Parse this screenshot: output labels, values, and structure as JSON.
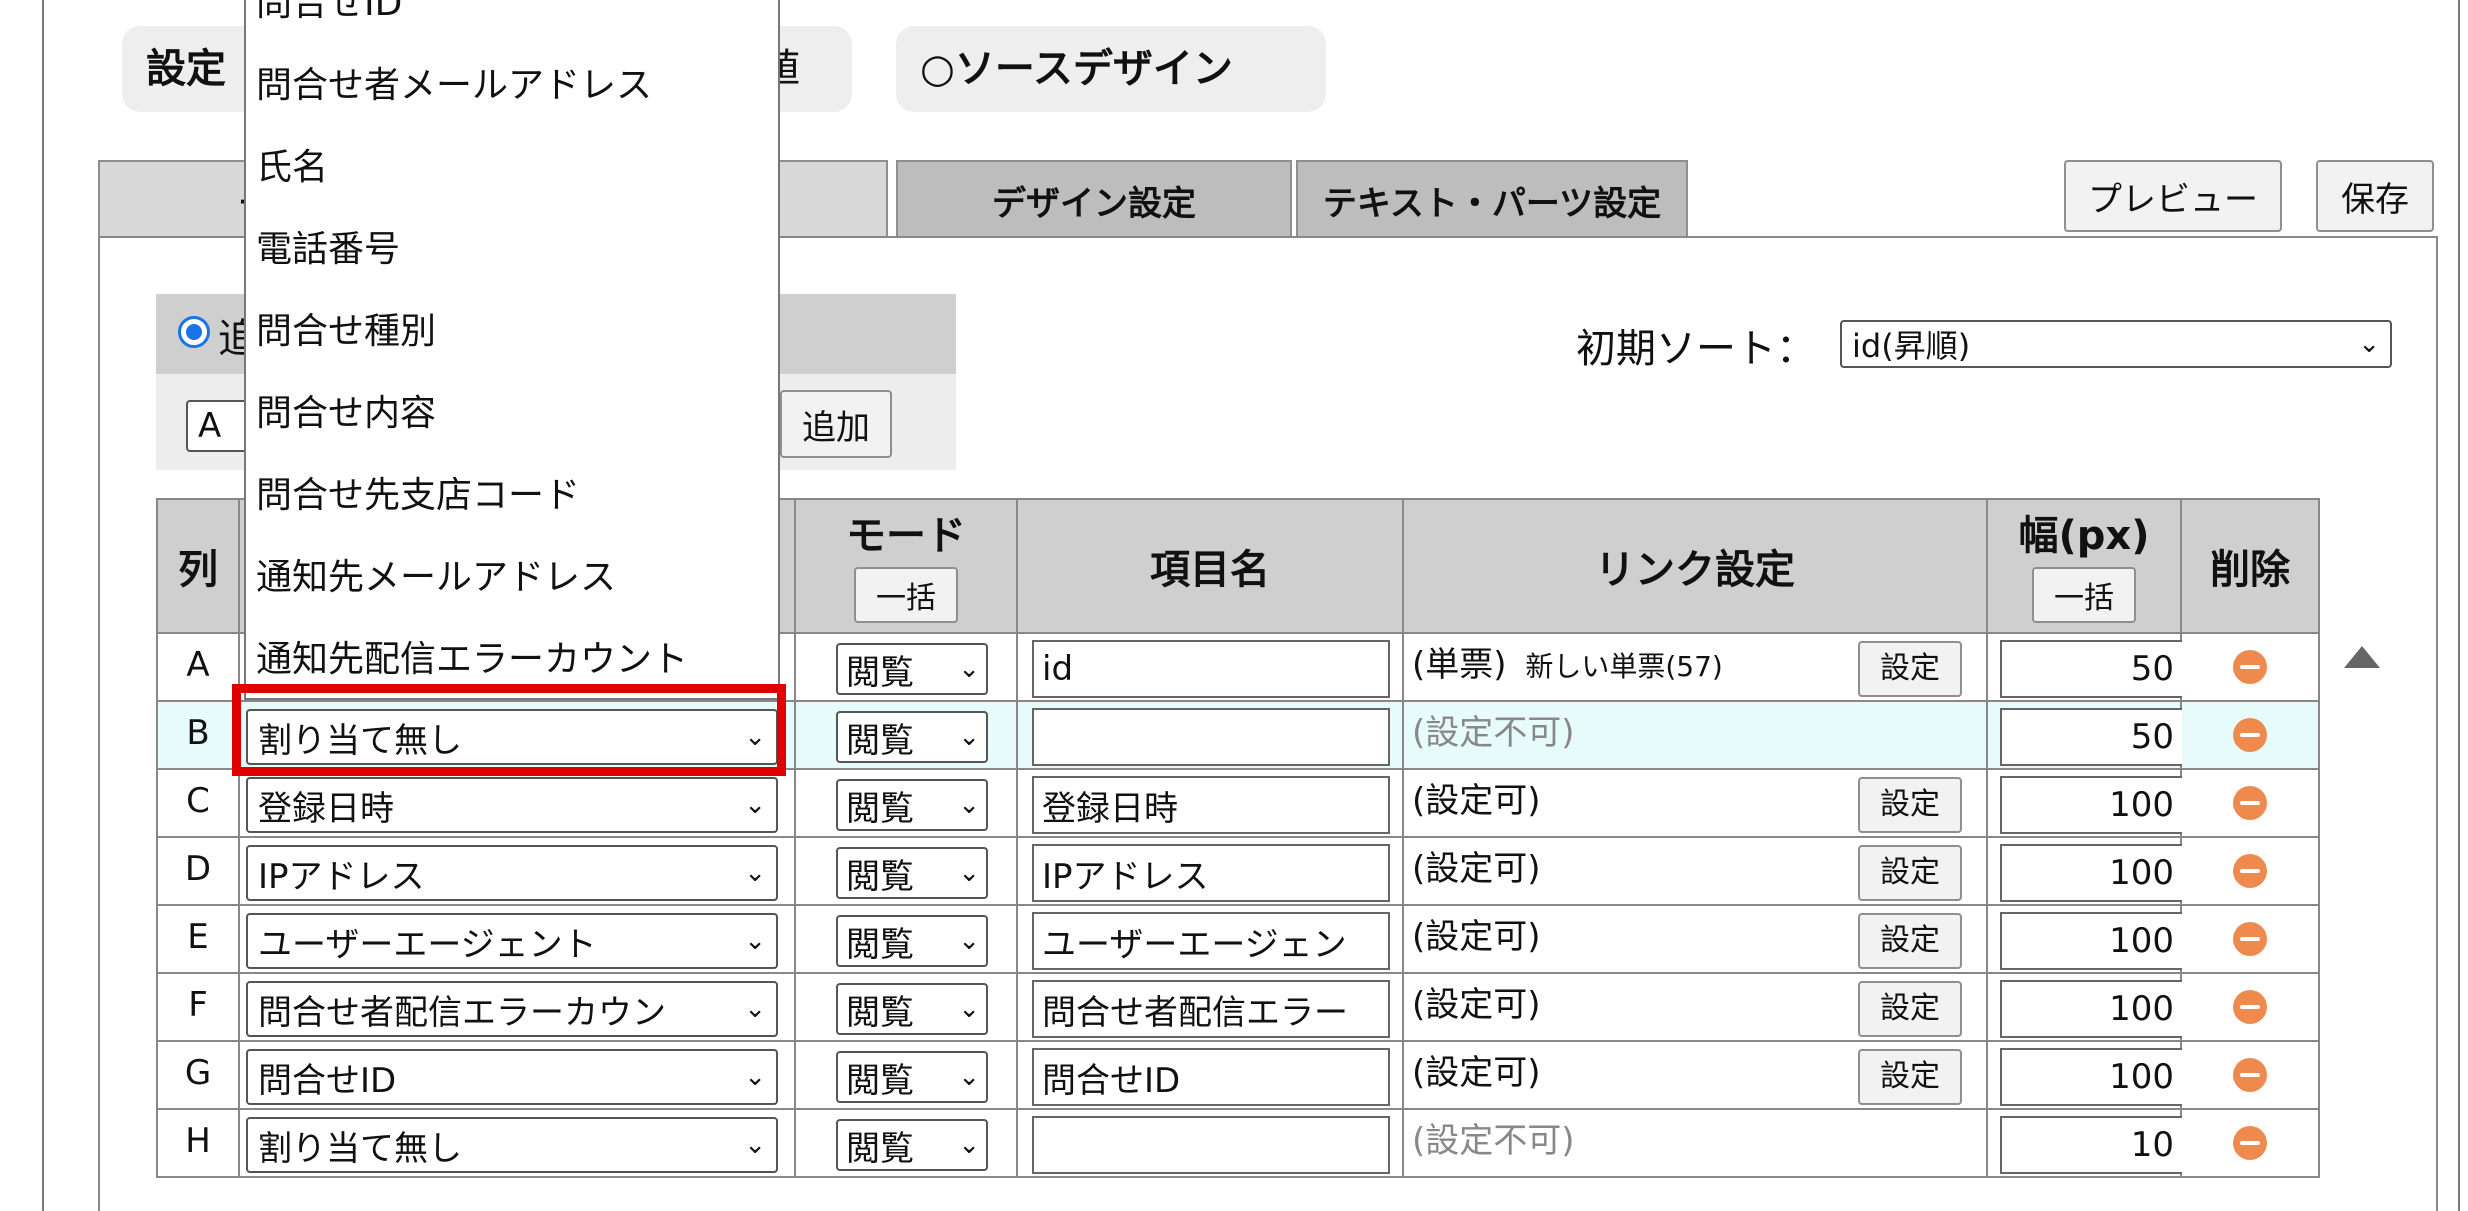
{
  "mode": {
    "left_label_partial": "設定",
    "left_trailing_partial": "値",
    "source_design_label": "○ソースデザイン"
  },
  "tabs": {
    "first_partial": "一",
    "design": "デザイン設定",
    "text_parts": "テキスト・パーツ設定",
    "preview": "プレビュー",
    "save": "保存"
  },
  "add_panel": {
    "radio_label_partial": "追",
    "column_select_value": "A",
    "add_button": "追加"
  },
  "sort": {
    "label": "初期ソート：",
    "value": "id(昇順)"
  },
  "table": {
    "headers": {
      "col": "列",
      "mode": "モード",
      "mode_bulk": "一括",
      "item_name": "項目名",
      "link": "リンク設定",
      "width": "幅(px)",
      "width_bulk": "一括",
      "delete": "削除"
    },
    "setting_button": "設定",
    "rows": [
      {
        "col": "A",
        "field": "",
        "mode": "閲覧",
        "name": "id",
        "link_main": "(単票)",
        "link_sub": "新しい単票(57)",
        "link_enabled": true,
        "width": "50"
      },
      {
        "col": "B",
        "field": "割り当て無し",
        "mode": "閲覧",
        "name": "",
        "link_main": "(設定不可)",
        "link_sub": "",
        "link_enabled": false,
        "width": "50"
      },
      {
        "col": "C",
        "field": "登録日時",
        "mode": "閲覧",
        "name": "登録日時",
        "link_main": "(設定可)",
        "link_sub": "",
        "link_enabled": true,
        "width": "100"
      },
      {
        "col": "D",
        "field": "IPアドレス",
        "mode": "閲覧",
        "name": "IPアドレス",
        "link_main": "(設定可)",
        "link_sub": "",
        "link_enabled": true,
        "width": "100"
      },
      {
        "col": "E",
        "field": "ユーザーエージェント",
        "mode": "閲覧",
        "name": "ユーザーエージェン",
        "link_main": "(設定可)",
        "link_sub": "",
        "link_enabled": true,
        "width": "100"
      },
      {
        "col": "F",
        "field": "問合せ者配信エラーカウン",
        "mode": "閲覧",
        "name": "問合せ者配信エラー",
        "link_main": "(設定可)",
        "link_sub": "",
        "link_enabled": true,
        "width": "100"
      },
      {
        "col": "G",
        "field": "問合せID",
        "mode": "閲覧",
        "name": "問合せID",
        "link_main": "(設定可)",
        "link_sub": "",
        "link_enabled": true,
        "width": "100"
      },
      {
        "col": "H",
        "field": "割り当て無し",
        "mode": "閲覧",
        "name": "",
        "link_main": "(設定不可)",
        "link_sub": "",
        "link_enabled": false,
        "width": "10"
      }
    ]
  },
  "dropdown": {
    "items": [
      "問合せID",
      "問合せ者メールアドレス",
      "氏名",
      "電話番号",
      "問合せ種別",
      "問合せ内容",
      "問合せ先支店コード",
      "通知先メールアドレス",
      "通知先配信エラーカウント"
    ]
  },
  "colors": {
    "highlight_border": "#e00000",
    "delete_icon": "#ef8a4f",
    "selected_row_bg": "#e8fbfb",
    "header_bg": "#cfcfcf"
  }
}
